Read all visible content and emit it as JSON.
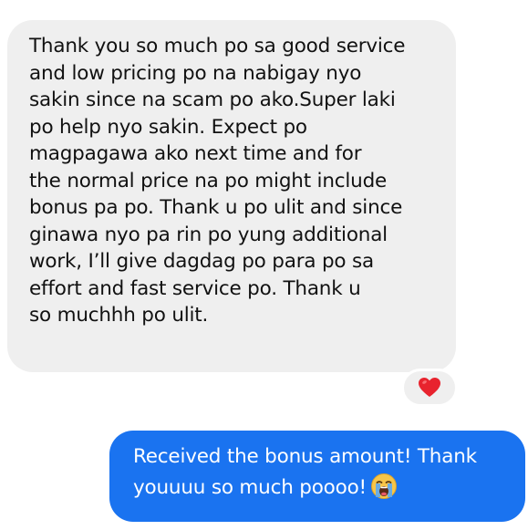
{
  "conversation": {
    "incoming_message": {
      "text": "Thank you so much po sa good service\nand low pricing po na nabigay nyo\nsakin since na scam po ako.Super laki\npo help nyo sakin. Expect po\nmagpagawa ako next time and for\nthe normal price na po might include\nbonus pa po. Thank u po ulit and since\nginawa nyo pa rin po yung additional\nwork, I’ll give dagdag po para po sa\neffort and fast service po. Thank u\nso muchhh po ulit.",
      "reaction_icon": "red-heart-icon"
    },
    "outgoing_message": {
      "text": "Received the bonus amount! Thank\nyouuuu so much poooo!",
      "emoji_icon": "loudly-crying-face-icon"
    }
  },
  "colors": {
    "incoming_bubble": "#efefef",
    "outgoing_bubble": "#1a73f0",
    "heart": "#e8232e",
    "outgoing_text": "#ffffff",
    "incoming_text": "#111111"
  }
}
